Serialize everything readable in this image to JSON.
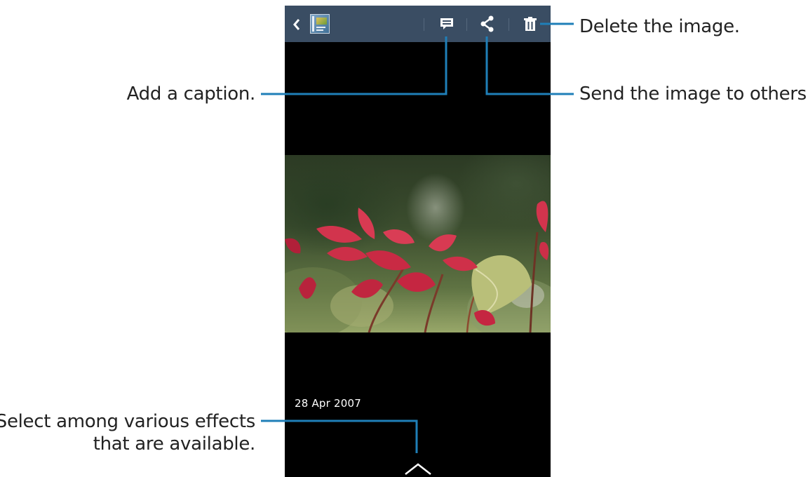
{
  "app": {
    "screen": "Image viewer"
  },
  "actionbar": {
    "back_icon": "chevron-left-icon",
    "album_icon": "album-thumbnail-icon",
    "caption_icon": "comment-icon",
    "share_icon": "share-icon",
    "delete_icon": "trash-icon",
    "background": "#3a4d63"
  },
  "photo": {
    "subject": "image"
  },
  "date_label": "28 Apr 2007",
  "effects_icon": "chevron-up-icon",
  "callouts": {
    "delete": "Delete the image.",
    "send": "Send the image to others.",
    "caption": "Add a caption.",
    "effects_line1": "Select among various effects",
    "effects_line2": "that are available."
  },
  "colors": {
    "leader_line": "#1f7fb8",
    "screen_bg": "#000000"
  }
}
